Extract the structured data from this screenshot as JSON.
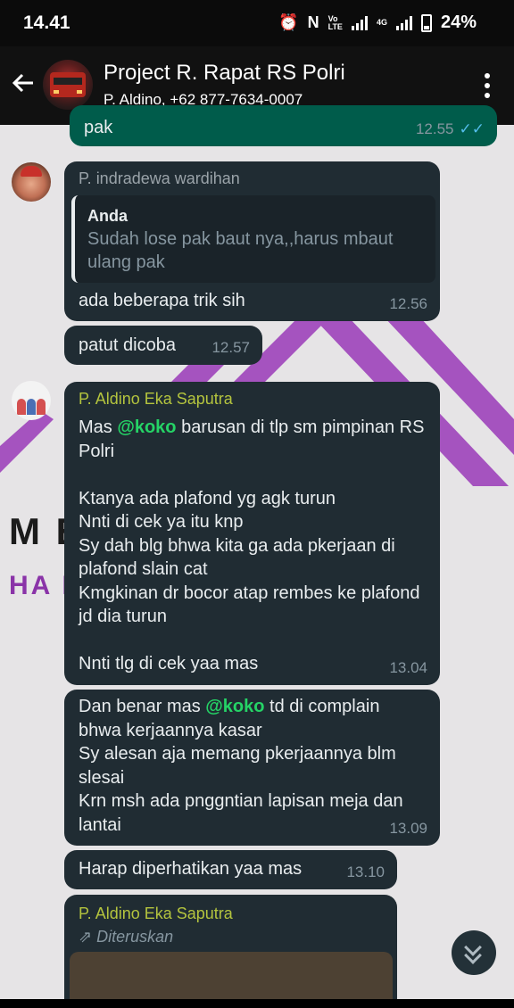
{
  "status_bar": {
    "time": "14.41",
    "alarm_icon": "⏰",
    "nfc_icon": "N",
    "volte_top": "Vo",
    "volte_bottom": "LTE",
    "net_label": "4G",
    "battery": "24%"
  },
  "header": {
    "title": "Project R. Rapat RS Polri",
    "subtitle": "P. Aldino, +62 877-7634-0007"
  },
  "background": {
    "line1": "M          ERIC",
    "line2": "HA                    RJAN"
  },
  "messages": [
    {
      "text": "pak",
      "time": "12.55"
    },
    {
      "sender": "P. indradewa wardihan",
      "quote_author": "Anda",
      "quote_text": "Sudah lose pak baut nya,,harus mbaut ulang pak",
      "text": "ada beberapa trik sih",
      "time": "12.56"
    },
    {
      "text": "patut dicoba",
      "time": "12.57"
    },
    {
      "sender": "P. Aldino Eka Saputra",
      "p1": "Mas ",
      "mention": "@koko",
      "p2": " barusan di tlp sm pimpinan RS Polri",
      "lines": [
        "Ktanya ada plafond yg agk turun",
        "Nnti di cek ya itu knp",
        "Sy dah blg bhwa kita ga ada pkerjaan di plafond slain cat",
        "Kmgkinan dr bocor atap rembes ke plafond jd dia turun",
        "Nnti tlg di cek yaa mas"
      ],
      "time": "13.04"
    },
    {
      "p1": "Dan benar mas ",
      "mention": "@koko",
      "p2": " td di complain bhwa kerjaannya kasar",
      "lines": [
        "Sy alesan aja memang pkerjaannya blm slesai",
        "Krn msh ada pnggntian lapisan meja dan lantai"
      ],
      "time": "13.09"
    },
    {
      "text": "Harap diperhatikan yaa mas",
      "time": "13.10"
    },
    {
      "sender": "P. Aldino Eka Saputra",
      "forwarded": "Diteruskan"
    }
  ],
  "colors": {
    "sender1": "#9aa3a9",
    "sender2": "#b4c43e",
    "mention": "#25d366",
    "tick": "#53bdeb"
  },
  "icons": [
    "back-arrow-icon",
    "more-vert-icon",
    "double-tick-icon",
    "forward-icon",
    "scroll-down-icon"
  ]
}
